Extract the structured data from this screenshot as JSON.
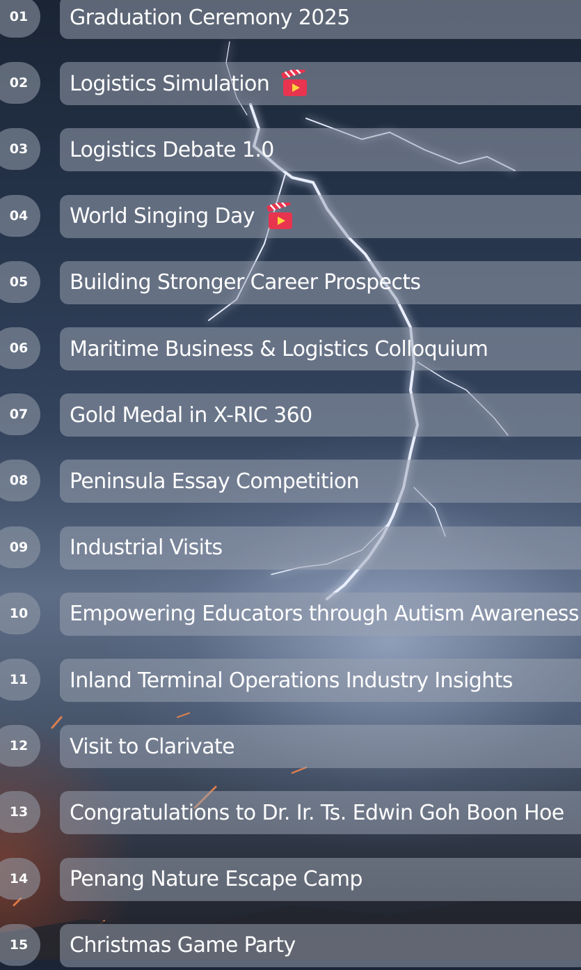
{
  "items": [
    {
      "num": "01",
      "title": "Graduation Ceremony 2025",
      "video": false
    },
    {
      "num": "02",
      "title": "Logistics Simulation",
      "video": true
    },
    {
      "num": "03",
      "title": "Logistics Debate 1.0",
      "video": false
    },
    {
      "num": "04",
      "title": "World Singing Day",
      "video": true
    },
    {
      "num": "05",
      "title": "Building Stronger Career Prospects",
      "video": false
    },
    {
      "num": "06",
      "title": "Maritime Business & Logistics Colloquium",
      "video": false
    },
    {
      "num": "07",
      "title": "Gold Medal in X-RIC 360",
      "video": false
    },
    {
      "num": "08",
      "title": "Peninsula Essay Competition",
      "video": false
    },
    {
      "num": "09",
      "title": "Industrial Visits",
      "video": false
    },
    {
      "num": "10",
      "title": "Empowering Educators through Autism Awareness",
      "video": false
    },
    {
      "num": "11",
      "title": "Inland Terminal Operations Industry Insights",
      "video": false
    },
    {
      "num": "12",
      "title": "Visit to Clarivate",
      "video": false
    },
    {
      "num": "13",
      "title": "Congratulations to Dr. Ir. Ts. Edwin Goh Boon Hoe",
      "video": false
    },
    {
      "num": "14",
      "title": "Penang Nature Escape Camp",
      "video": false
    },
    {
      "num": "15",
      "title": "Christmas Game Party",
      "video": false
    }
  ],
  "icons": {
    "video": "clapperboard-icon"
  },
  "colors": {
    "pill": "#9ba3b2",
    "text": "#ffffff",
    "clapper": "#e8344e"
  }
}
